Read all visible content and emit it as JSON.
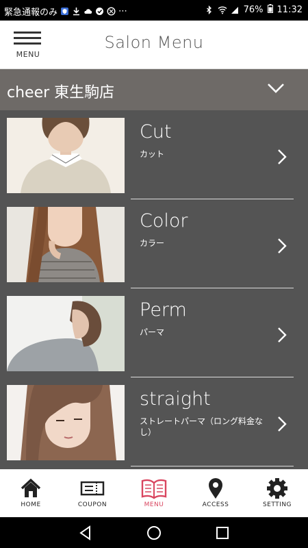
{
  "status_bar": {
    "notification_text": "緊急通報のみ",
    "battery": "76%",
    "time": "11:32"
  },
  "header": {
    "menu_label": "MENU",
    "title": "Salon Menu"
  },
  "store": {
    "name": "cheer 東生駒店"
  },
  "menu_items": [
    {
      "title": "Cut",
      "subtitle": "カット"
    },
    {
      "title": "Color",
      "subtitle": "カラー"
    },
    {
      "title": "Perm",
      "subtitle": "パーマ"
    },
    {
      "title": "straight",
      "subtitle": "ストレートパーマ（ロング料金なし）"
    }
  ],
  "tabs": [
    {
      "label": "HOME",
      "icon": "home-icon"
    },
    {
      "label": "COUPON",
      "icon": "coupon-icon"
    },
    {
      "label": "MENU",
      "icon": "book-icon",
      "active": true
    },
    {
      "label": "ACCESS",
      "icon": "map-pin-icon"
    },
    {
      "label": "SETTING",
      "icon": "gear-icon"
    }
  ],
  "colors": {
    "accent": "#d9455f",
    "list_background": "#545454",
    "store_bar": "#6e6a67"
  }
}
